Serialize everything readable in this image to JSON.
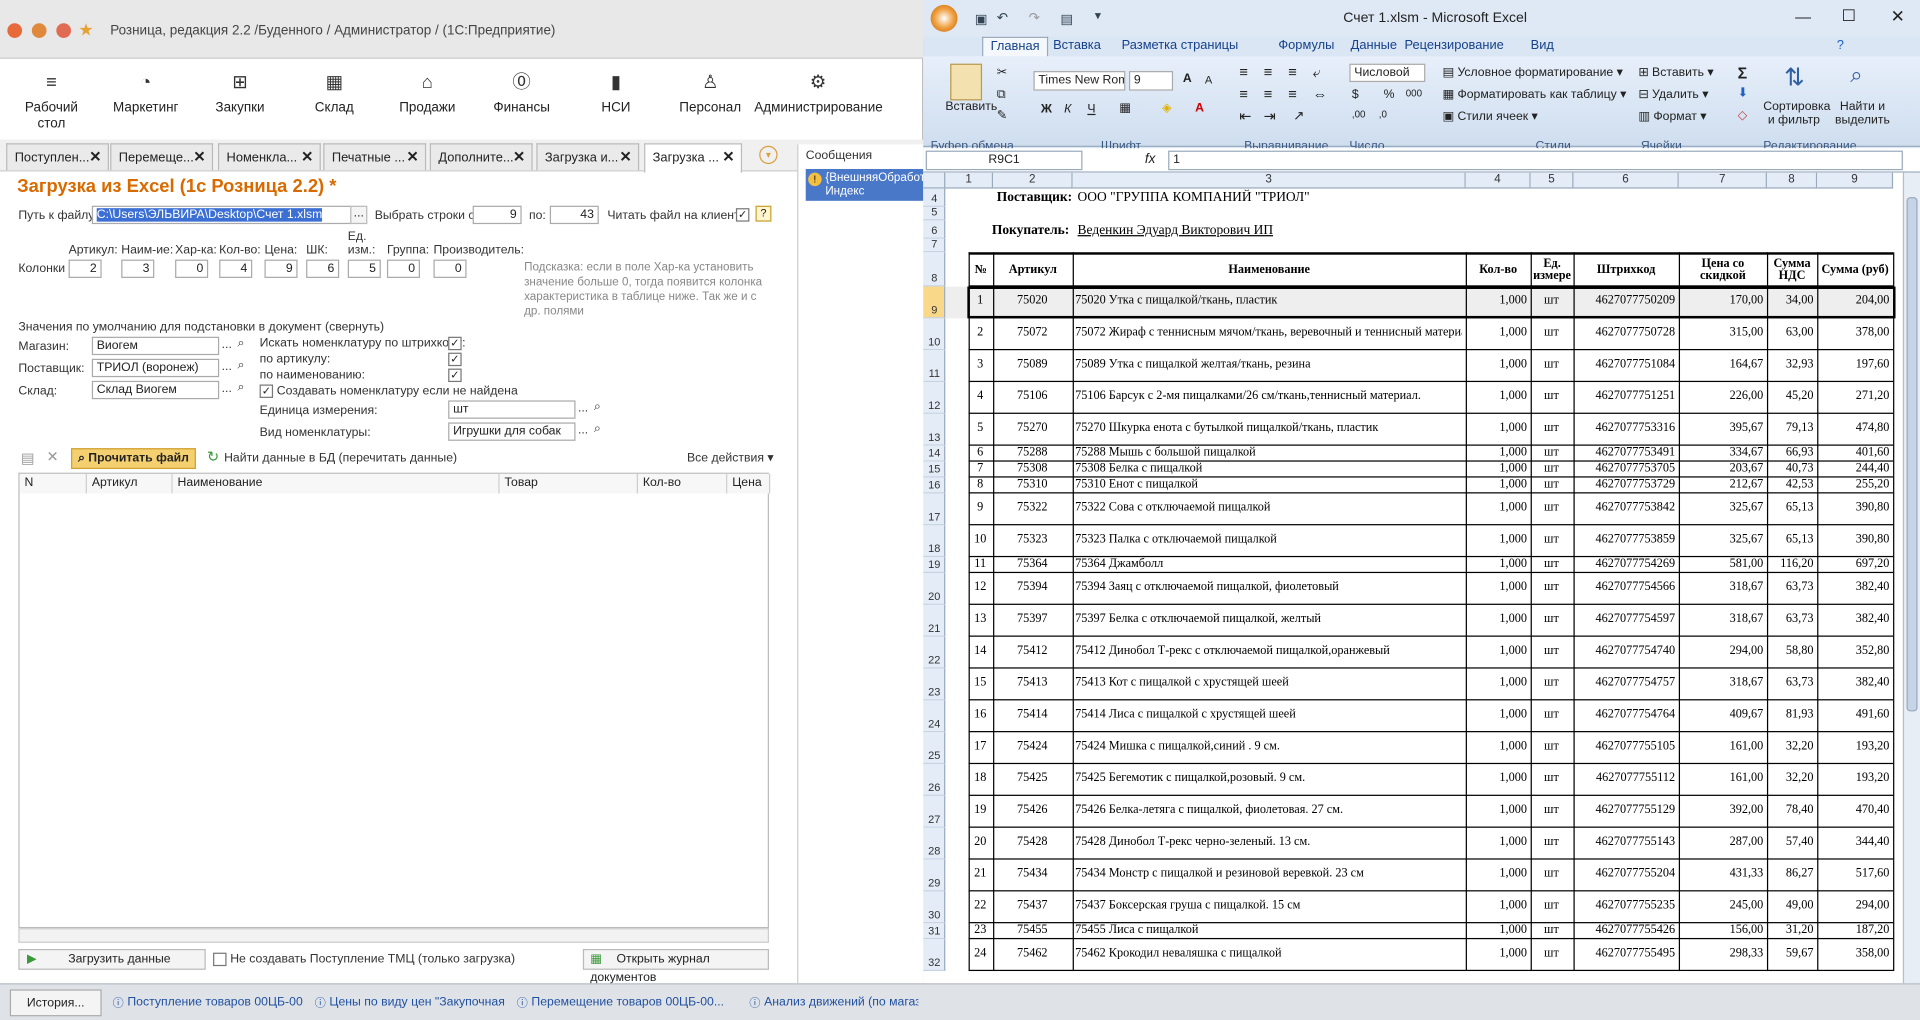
{
  "onec": {
    "window_title": "Розница, редакция 2.2 /Буденного / Администратор /  (1С:Предприятие)",
    "user": "Админ",
    "sections": [
      "Рабочий\nстол",
      "Маркетинг",
      "Закупки",
      "Склад",
      "Продажи",
      "Финансы",
      "НСИ",
      "Персонал",
      "Администрирование"
    ],
    "tabs": [
      "Поступлен...",
      "Перемеще...",
      "Номенкла...",
      "Печатные ...",
      "Дополните...",
      "Загрузка и...",
      "Загрузка ..."
    ],
    "form_title": "Загрузка из Excel (1с Розница 2.2) *",
    "path_label": "Путь к файлу:",
    "path_value": "C:\\Users\\ЭЛЬВИРА\\Desktop\\Счет 1.xlsm",
    "rows_from_label": "Выбрать строки с:",
    "rows_from": "9",
    "rows_to_label": "по:",
    "rows_to": "43",
    "read_client_label": "Читать файл на клиенте:",
    "columns_label": "Колонки",
    "col_labels": [
      "Артикул:",
      "Наим-ие:",
      "Хар-ка:",
      "Кол-во:",
      "Цена:",
      "ШК:",
      "Ед. изм.:",
      "Группа:",
      "Производитель:"
    ],
    "col_values": [
      "2",
      "3",
      "0",
      "4",
      "9",
      "6",
      "5",
      "0",
      "0"
    ],
    "hint": "Подсказка: если в поле Хар-ка установить значение больше 0, тогда появится колонка характеристика в таблице ниже. Так же и с др. полями",
    "defaults_label": "Значения по умолчанию для подстановки в документ (свернуть)",
    "shop_label": "Магазин:",
    "shop_value": "Виогем",
    "supplier_label": "Поставщик:",
    "supplier_value": "ТРИОЛ (воронеж)",
    "warehouse_label": "Склад:",
    "warehouse_value": "Склад Виогем",
    "search_barcode": "Искать номенклатуру по штрихкоду:",
    "by_article": "по артикулу:",
    "by_name": "по наименованию:",
    "create_item": "Создавать номенклатуру если не найдена",
    "unit_label": "Единица измерения:",
    "unit_value": "шт",
    "kind_label": "Вид номенклатуры:",
    "kind_value": "Игрушки для собак",
    "read_file_btn": "Прочитать файл",
    "find_db_btn": "Найти данные в БД (перечитать данные)",
    "all_actions": "Все действия",
    "table_headers": [
      "N",
      "Артикул",
      "Наименование",
      "Товар",
      "Кол-во",
      "Цена"
    ],
    "load_btn": "Загрузить данные",
    "no_create_label": "Не создавать Поступление ТМЦ (только загрузка)",
    "journal_btn": "Открыть журнал документов",
    "messages_title": "Сообщения",
    "message_text": "{ВнешняяОбработ... Индекс находитс..."
  },
  "taskbar": [
    "История...",
    "Поступление товаров 00ЦБ-00...",
    "Цены по виду цен \"Закупочная ...",
    "Перемещение товаров 00ЦБ-00...",
    "Анализ движений (по магазинам)"
  ],
  "excel": {
    "title": "Счет 1.xlsm - Microsoft Excel",
    "ribbon_tabs": [
      "Главная",
      "Вставка",
      "Разметка страницы",
      "Формулы",
      "Данные",
      "Рецензирование",
      "Вид"
    ],
    "font_name": "Times New Rom",
    "font_size": "9",
    "number_format": "Числовой",
    "groups": [
      "Буфер обмена",
      "Шрифт",
      "Выравнивание",
      "Число",
      "Стили",
      "Ячейки",
      "Редактирование"
    ],
    "paste": "Вставить",
    "cond_format": "Условное форматирование",
    "format_table": "Форматировать как таблицу",
    "cell_styles": "Стили ячеек",
    "insert": "Вставить",
    "delete": "Удалить",
    "format": "Формат",
    "sort_filter": "Сортировка и фильтр",
    "find_select": "Найти и выделить",
    "name_box": "R9C1",
    "formula_value": "1",
    "col_headers": [
      "1",
      "2",
      "3",
      "4",
      "5",
      "6",
      "7",
      "8",
      "9"
    ],
    "supplier_label": "Поставщик:",
    "supplier_value": "ООО \"ГРУППА КОМПАНИЙ \"ТРИОЛ\"",
    "buyer_label": "Покупатель:",
    "buyer_value": "Веденкин Эдуард Викторович ИП",
    "table_headers": [
      "№",
      "Артикул",
      "Наименование",
      "Кол-во",
      "Ед. измере",
      "Штрихкод",
      "Цена со скидкой",
      "Сумма НДС",
      "Сумма (руб)"
    ],
    "row_nums_top": [
      "4",
      "5",
      "6",
      "7",
      "8"
    ],
    "rows": [
      {
        "r": "9",
        "n": "1",
        "art": "75020",
        "name": "75020 Утка с пищалкой/ткань, пластик",
        "qty": "1,000",
        "unit": "шт",
        "bc": "4627077750209",
        "price": "170,00",
        "vat": "34,00",
        "sum": "204,00"
      },
      {
        "r": "10",
        "n": "2",
        "art": "75072",
        "name": "75072 Жираф с теннисным мячом/ткань, веревочный и теннисный материал",
        "qty": "1,000",
        "unit": "шт",
        "bc": "4627077750728",
        "price": "315,00",
        "vat": "63,00",
        "sum": "378,00"
      },
      {
        "r": "11",
        "n": "3",
        "art": "75089",
        "name": "75089 Утка с пищалкой желтая/ткань, резина",
        "qty": "1,000",
        "unit": "шт",
        "bc": "4627077751084",
        "price": "164,67",
        "vat": "32,93",
        "sum": "197,60"
      },
      {
        "r": "12",
        "n": "4",
        "art": "75106",
        "name": "75106 Барсук с 2-мя пищалками/26 см/ткань,теннисный материал.",
        "qty": "1,000",
        "unit": "шт",
        "bc": "4627077751251",
        "price": "226,00",
        "vat": "45,20",
        "sum": "271,20"
      },
      {
        "r": "13",
        "n": "5",
        "art": "75270",
        "name": "75270 Шкурка енота с бутылкой пищалкой/ткань, пластик",
        "qty": "1,000",
        "unit": "шт",
        "bc": "4627077753316",
        "price": "395,67",
        "vat": "79,13",
        "sum": "474,80"
      },
      {
        "r": "14",
        "n": "6",
        "art": "75288",
        "name": "75288 Мышь с большой пищалкой",
        "qty": "1,000",
        "unit": "шт",
        "bc": "4627077753491",
        "price": "334,67",
        "vat": "66,93",
        "sum": "401,60"
      },
      {
        "r": "15",
        "n": "7",
        "art": "75308",
        "name": "75308 Белка с пищалкой",
        "qty": "1,000",
        "unit": "шт",
        "bc": "4627077753705",
        "price": "203,67",
        "vat": "40,73",
        "sum": "244,40"
      },
      {
        "r": "16",
        "n": "8",
        "art": "75310",
        "name": "75310 Енот с пищалкой",
        "qty": "1,000",
        "unit": "шт",
        "bc": "4627077753729",
        "price": "212,67",
        "vat": "42,53",
        "sum": "255,20"
      },
      {
        "r": "17",
        "n": "9",
        "art": "75322",
        "name": "75322 Сова с отключаемой пищалкой",
        "qty": "1,000",
        "unit": "шт",
        "bc": "4627077753842",
        "price": "325,67",
        "vat": "65,13",
        "sum": "390,80"
      },
      {
        "r": "18",
        "n": "10",
        "art": "75323",
        "name": "75323 Палка с отключаемой пищалкой",
        "qty": "1,000",
        "unit": "шт",
        "bc": "4627077753859",
        "price": "325,67",
        "vat": "65,13",
        "sum": "390,80"
      },
      {
        "r": "19",
        "n": "11",
        "art": "75364",
        "name": "75364 Джамболл",
        "qty": "1,000",
        "unit": "шт",
        "bc": "4627077754269",
        "price": "581,00",
        "vat": "116,20",
        "sum": "697,20"
      },
      {
        "r": "20",
        "n": "12",
        "art": "75394",
        "name": "75394 Заяц с отключаемой пищалкой, фиолетовый",
        "qty": "1,000",
        "unit": "шт",
        "bc": "4627077754566",
        "price": "318,67",
        "vat": "63,73",
        "sum": "382,40"
      },
      {
        "r": "21",
        "n": "13",
        "art": "75397",
        "name": "75397 Белка с отключаемой пищалкой, желтый",
        "qty": "1,000",
        "unit": "шт",
        "bc": "4627077754597",
        "price": "318,67",
        "vat": "63,73",
        "sum": "382,40"
      },
      {
        "r": "22",
        "n": "14",
        "art": "75412",
        "name": "75412 Динобол Т-рекс с отключаемой пищалкой,оранжевый",
        "qty": "1,000",
        "unit": "шт",
        "bc": "4627077754740",
        "price": "294,00",
        "vat": "58,80",
        "sum": "352,80"
      },
      {
        "r": "23",
        "n": "15",
        "art": "75413",
        "name": "75413 Кот с пищалкой с хрустящей шеей",
        "qty": "1,000",
        "unit": "шт",
        "bc": "4627077754757",
        "price": "318,67",
        "vat": "63,73",
        "sum": "382,40"
      },
      {
        "r": "24",
        "n": "16",
        "art": "75414",
        "name": "75414 Лиса с пищалкой с хрустящей шеей",
        "qty": "1,000",
        "unit": "шт",
        "bc": "4627077754764",
        "price": "409,67",
        "vat": "81,93",
        "sum": "491,60"
      },
      {
        "r": "25",
        "n": "17",
        "art": "75424",
        "name": "75424 Мишка с пищалкой,синий . 9 см.",
        "qty": "1,000",
        "unit": "шт",
        "bc": "4627077755105",
        "price": "161,00",
        "vat": "32,20",
        "sum": "193,20"
      },
      {
        "r": "26",
        "n": "18",
        "art": "75425",
        "name": "75425 Бегемотик  с пищалкой,розовый. 9 см.",
        "qty": "1,000",
        "unit": "шт",
        "bc": "4627077755112",
        "price": "161,00",
        "vat": "32,20",
        "sum": "193,20"
      },
      {
        "r": "27",
        "n": "19",
        "art": "75426",
        "name": "75426 Белка-летяга с пищалкой, фиолетовая. 27 см.",
        "qty": "1,000",
        "unit": "шт",
        "bc": "4627077755129",
        "price": "392,00",
        "vat": "78,40",
        "sum": "470,40"
      },
      {
        "r": "28",
        "n": "20",
        "art": "75428",
        "name": "75428 Динобол Т-рекс черно-зеленый. 13 см.",
        "qty": "1,000",
        "unit": "шт",
        "bc": "4627077755143",
        "price": "287,00",
        "vat": "57,40",
        "sum": "344,40"
      },
      {
        "r": "29",
        "n": "21",
        "art": "75434",
        "name": "75434 Монстр с пищалкой и резиновой веревкой. 23 см",
        "qty": "1,000",
        "unit": "шт",
        "bc": "4627077755204",
        "price": "431,33",
        "vat": "86,27",
        "sum": "517,60"
      },
      {
        "r": "30",
        "n": "22",
        "art": "75437",
        "name": "75437 Боксерская груша с пищалкой. 15 см",
        "qty": "1,000",
        "unit": "шт",
        "bc": "4627077755235",
        "price": "245,00",
        "vat": "49,00",
        "sum": "294,00"
      },
      {
        "r": "31",
        "n": "23",
        "art": "75455",
        "name": "75455 Лиса с пищалкой",
        "qty": "1,000",
        "unit": "шт",
        "bc": "4627077755426",
        "price": "156,00",
        "vat": "31,20",
        "sum": "187,20"
      },
      {
        "r": "32",
        "n": "24",
        "art": "75462",
        "name": "75462 Крокодил неваляшка с пищалкой",
        "qty": "1,000",
        "unit": "шт",
        "bc": "4627077755495",
        "price": "298,33",
        "vat": "59,67",
        "sum": "358,00"
      }
    ]
  }
}
